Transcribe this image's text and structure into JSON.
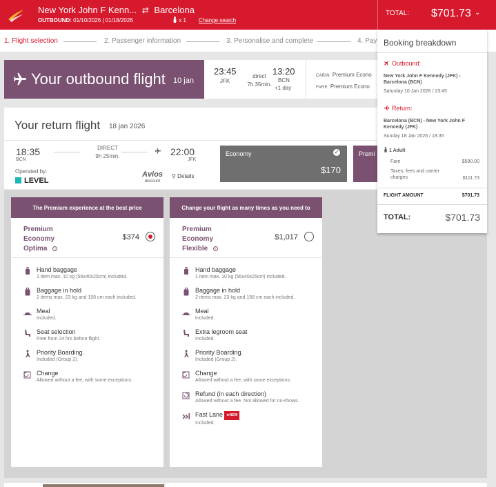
{
  "header": {
    "origin": "New York John F Kenn...",
    "destination": "Barcelona",
    "dates_label": "OUTBOUND:",
    "dates_value": "01/10/2026 | 01/18/2026",
    "passengers": "x 1",
    "change_search": "Change search",
    "total_label": "TOTAL:",
    "total_amount": "$701.73"
  },
  "steps": [
    "1. Flight selection",
    "2. Passenger information",
    "3. Personalise and complete",
    "4. Pay"
  ],
  "outbound": {
    "title": "Your outbound flight",
    "date": "10 jan",
    "dep_time": "23:45",
    "dep_airport": "JFK",
    "direct": "direct",
    "duration": "7h 35min.",
    "arr_time": "13:20",
    "arr_airport": "BCN",
    "plus_day": "+1 day",
    "cabin_label": "CABIN",
    "cabin_value": "Premium Econo",
    "fare_label": "FARE",
    "fare_value": "Premium Econo"
  },
  "return": {
    "title": "Your return flight",
    "date": "18 jan 2026",
    "dep_time": "18:35",
    "dep_airport": "BCN",
    "direct": "DIRECT",
    "duration": "9h 25min.",
    "arr_time": "22:00",
    "arr_airport": "JFK",
    "operated_by": "Operated by:",
    "airline": "LEVEL",
    "avios": "Avios",
    "avios_sub": "discount",
    "details": "Details",
    "economy_label": "Economy",
    "economy_price": "$170",
    "premium_label": "Premi"
  },
  "fares": [
    {
      "header": "The Premium experience at the best price",
      "name": [
        "Premium",
        "Economy",
        "Optima"
      ],
      "price": "$374",
      "selected": true,
      "features": [
        {
          "icon": "hand-baggage-icon",
          "title": "Hand baggage",
          "desc": "1 item max. 10 kg (56x40x25cm) included."
        },
        {
          "icon": "hold-baggage-icon",
          "title": "Baggage in hold",
          "desc": "2 items max. 23 kg and 158 cm each included."
        },
        {
          "icon": "meal-icon",
          "title": "Meal",
          "desc": "Included."
        },
        {
          "icon": "seat-icon",
          "title": "Seat selection",
          "desc": "Free from 24 hrs before flight."
        },
        {
          "icon": "priority-boarding-icon",
          "title": "Priority Boarding.",
          "desc": "Included (Group 2)."
        },
        {
          "icon": "change-icon",
          "title": "Change",
          "desc": "Allowed without a fee, with some exceptions."
        }
      ]
    },
    {
      "header": "Change your flight as many times as you need to",
      "name": [
        "Premium",
        "Economy",
        "Flexible"
      ],
      "price": "$1,017",
      "selected": false,
      "features": [
        {
          "icon": "hand-baggage-icon",
          "title": "Hand baggage",
          "desc": "1 item max. 10 kg (56x40x25cm) included."
        },
        {
          "icon": "hold-baggage-icon",
          "title": "Baggage in hold",
          "desc": "2 items max. 23 kg and 158 cm each included."
        },
        {
          "icon": "meal-icon",
          "title": "Meal",
          "desc": "Included."
        },
        {
          "icon": "seat-icon",
          "title": "Extra legroom seat",
          "desc": "Included."
        },
        {
          "icon": "priority-boarding-icon",
          "title": "Priority Boarding.",
          "desc": "Included (Group 2)."
        },
        {
          "icon": "change-icon",
          "title": "Change",
          "desc": "Allowed without a fee, with some exceptions."
        },
        {
          "icon": "refund-icon",
          "title": "Refund (in each direction)",
          "desc": "Allowed without a fee. Not allowed for no-shows."
        },
        {
          "icon": "fast-lane-icon",
          "title": "Fast Lane",
          "desc": "Included.",
          "badge": "NEW"
        }
      ]
    }
  ],
  "breakdown": {
    "title": "Booking breakdown",
    "outbound_label": "Outbound:",
    "outbound_route": "New York John F Kennedy (JFK) - Barcelona (BCN)",
    "outbound_date": "Saturday 10 Jan 2026 / 23:45",
    "return_label": "Return:",
    "return_route": "Barcelona (BCN) - New York John F Kennedy (JFK)",
    "return_date": "Sunday 18 Jan 2026 / 18:35",
    "adults": "1 Adult",
    "fare_label": "Fare",
    "fare_value": "$590.00",
    "taxes_label": "Taxes, fees and carrier charges",
    "taxes_value": "$111.73",
    "flight_amount_label": "FLIGHT AMOUNT",
    "flight_amount_value": "$701.73",
    "total_label": "TOTAL:",
    "total_value": "$701.73"
  },
  "colors": {
    "brand_red": "#d7192d",
    "premium_purple": "#7a5171",
    "economy_grey": "#6f6f6f"
  }
}
